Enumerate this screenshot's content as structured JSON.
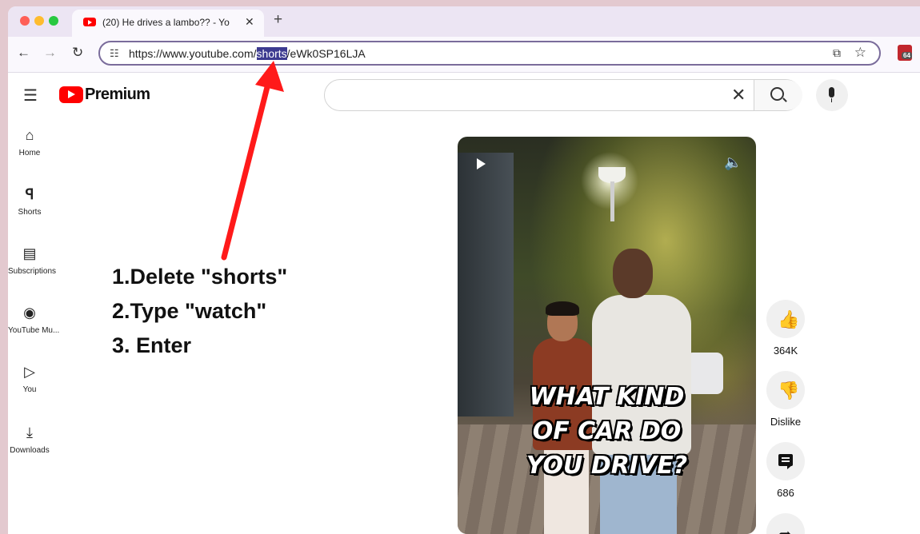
{
  "browser": {
    "tab_title": "(20) He drives a lambo?? - Yo",
    "tab_close": "✕",
    "new_tab": "+",
    "url_prefix": "https://www.youtube.com/",
    "url_highlight": "shorts",
    "url_suffix": "/eWk0SP16LJA",
    "extension_badge": "64",
    "icons": [
      "back-icon",
      "forward-icon",
      "reload-icon",
      "site-info-icon",
      "install-icon",
      "star-icon"
    ]
  },
  "youtube": {
    "logo_text": "Premium",
    "search_value": "",
    "sidebar": [
      {
        "label": "Home",
        "icon": "⌂"
      },
      {
        "label": "Shorts",
        "icon": "ꟼ"
      },
      {
        "label": "Subscriptions",
        "icon": "▤"
      },
      {
        "label": "YouTube Mu...",
        "icon": "◉"
      },
      {
        "label": "You",
        "icon": "▷"
      },
      {
        "label": "Downloads",
        "icon": "⤓"
      }
    ],
    "video_caption": [
      "WHAT KIND",
      "OF CAR DO",
      "YOU DRIVE?"
    ],
    "actions": {
      "likes": "364K",
      "dislike": "Dislike",
      "comments": "686"
    }
  },
  "annotation": {
    "steps": [
      "1.Delete \"shorts\"",
      "2.Type \"watch\"",
      "3. Enter"
    ],
    "arrow_color": "#ff1a1a"
  },
  "colors": {
    "youtube_red": "#ff0000",
    "url_highlight": "#3c3a90",
    "omnibox_border": "#7a6c9b"
  }
}
